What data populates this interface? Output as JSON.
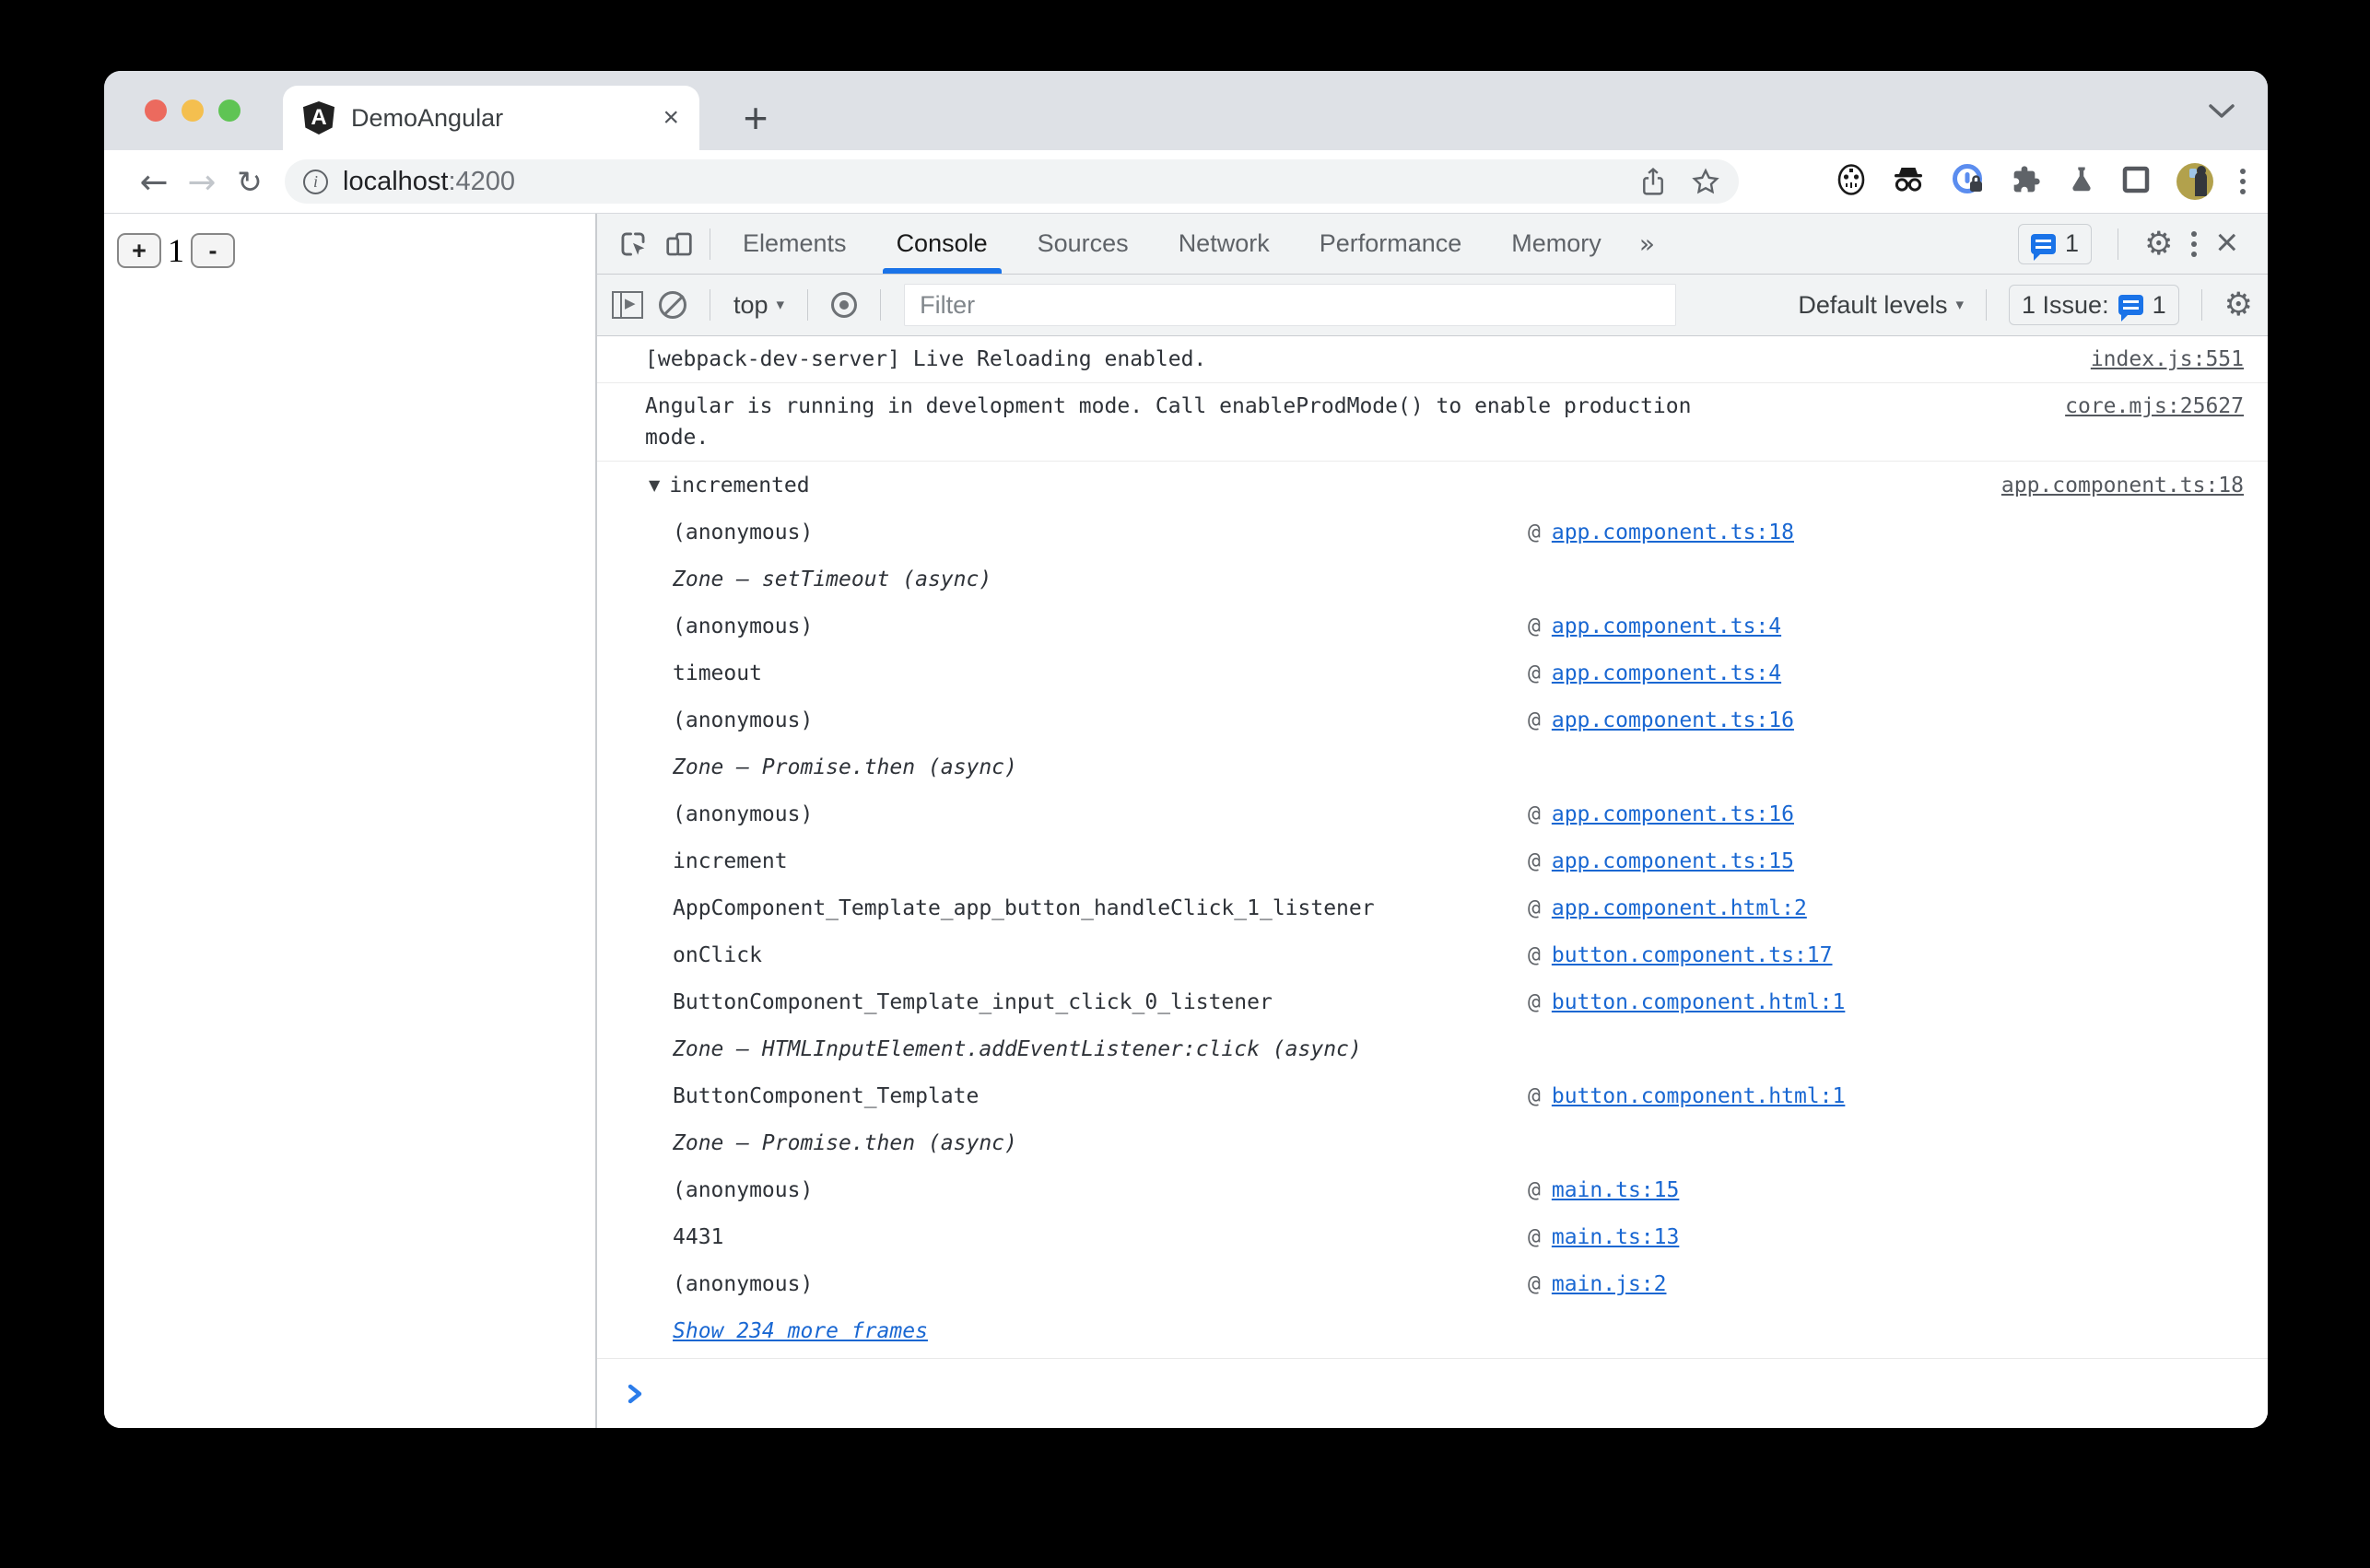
{
  "colors": {
    "accent_blue": "#1a73e8",
    "link_blue": "#1967d2",
    "tabstrip_bg": "#dee1e6",
    "toolbar_bg": "#f1f3f4",
    "console_text": "#2e3238",
    "muted_icon": "#5f6368"
  },
  "browser": {
    "traffic_lights": [
      "close",
      "minimize",
      "zoom"
    ],
    "tab": {
      "title": "DemoAngular",
      "close_label": "×",
      "favicon": "angular-shield-icon",
      "favicon_letter": "A"
    },
    "new_tab_label": "+",
    "back_label": "←",
    "forward_label": "→",
    "reload_label": "↻",
    "url_host": "localhost",
    "url_port": ":4200",
    "info_label": "i",
    "omnibox_icons": [
      "site-info-icon",
      "share-icon",
      "bookmark-star-icon"
    ],
    "extension_icons": [
      "mask-extension-icon",
      "incognito-extension-icon",
      "password-manager-extension-icon",
      "extensions-puzzle-icon",
      "labs-flask-icon",
      "side-panel-icon",
      "profile-avatar",
      "browser-menu-dots"
    ]
  },
  "page": {
    "increment_label": "+",
    "count": "1",
    "decrement_label": "-"
  },
  "devtools": {
    "tabs": [
      {
        "label": "Elements"
      },
      {
        "label": "Console"
      },
      {
        "label": "Sources"
      },
      {
        "label": "Network"
      },
      {
        "label": "Performance"
      },
      {
        "label": "Memory"
      }
    ],
    "active_tab": "Console",
    "more_tabs_label": "»",
    "header_issues_badge": "1",
    "gear_label": "⚙",
    "close_label": "×",
    "toolbar": {
      "context": "top",
      "caret": "▾",
      "filter_placeholder": "Filter",
      "levels": "Default levels",
      "issues_text": "1 Issue:",
      "issues_badge": "1"
    },
    "console": {
      "messages": [
        {
          "text": "[webpack-dev-server] Live Reloading enabled.",
          "source": "index.js:551"
        },
        {
          "text": "Angular is running in development mode. Call enableProdMode() to enable production mode.",
          "source": "core.mjs:25627"
        }
      ],
      "group": {
        "expander": "▼",
        "label": "incremented",
        "source": "app.component.ts:18",
        "at_symbol": "@",
        "frames": [
          {
            "fn": "(anonymous)",
            "file": "app.component.ts:18"
          },
          {
            "zone": "Zone — setTimeout (async)"
          },
          {
            "fn": "(anonymous)",
            "file": "app.component.ts:4"
          },
          {
            "fn": "timeout",
            "file": "app.component.ts:4"
          },
          {
            "fn": "(anonymous)",
            "file": "app.component.ts:16"
          },
          {
            "zone": "Zone — Promise.then (async)"
          },
          {
            "fn": "(anonymous)",
            "file": "app.component.ts:16"
          },
          {
            "fn": "increment",
            "file": "app.component.ts:15"
          },
          {
            "fn": "AppComponent_Template_app_button_handleClick_1_listener",
            "file": "app.component.html:2"
          },
          {
            "fn": "onClick",
            "file": "button.component.ts:17"
          },
          {
            "fn": "ButtonComponent_Template_input_click_0_listener",
            "file": "button.component.html:1"
          },
          {
            "zone": "Zone — HTMLInputElement.addEventListener:click (async)"
          },
          {
            "fn": "ButtonComponent_Template",
            "file": "button.component.html:1"
          },
          {
            "zone": "Zone — Promise.then (async)"
          },
          {
            "fn": "(anonymous)",
            "file": "main.ts:15"
          },
          {
            "fn": "4431",
            "file": "main.ts:13"
          },
          {
            "fn": "(anonymous)",
            "file": "main.js:2"
          },
          {
            "more": "Show 234 more frames"
          }
        ]
      }
    }
  }
}
